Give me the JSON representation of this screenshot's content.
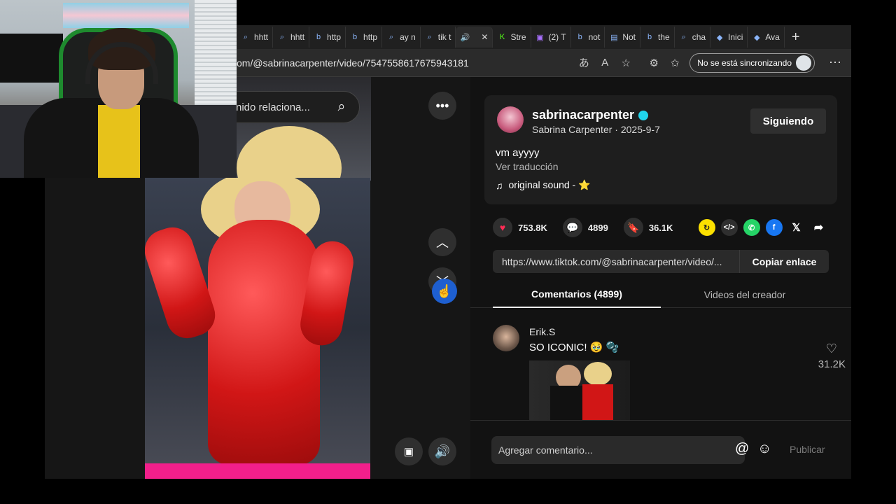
{
  "browser": {
    "tabs": [
      {
        "label": "hhtt",
        "icon": "search-icon"
      },
      {
        "label": "hhtt",
        "icon": "search-icon"
      },
      {
        "label": "http",
        "icon": "bing-icon"
      },
      {
        "label": "http",
        "icon": "bing-icon"
      },
      {
        "label": "ay n",
        "icon": "search-icon"
      },
      {
        "label": "tik t",
        "icon": "search-icon"
      },
      {
        "label": "",
        "icon": "speaker-icon",
        "active": true
      },
      {
        "label": "Stre",
        "icon": "kick-icon"
      },
      {
        "label": "(2) T",
        "icon": "twitch-icon"
      },
      {
        "label": "not",
        "icon": "bing-icon"
      },
      {
        "label": "Not",
        "icon": "page-icon"
      },
      {
        "label": "the",
        "icon": "bing-icon"
      },
      {
        "label": "cha",
        "icon": "search-icon"
      },
      {
        "label": "Inici",
        "icon": "roblox-icon"
      },
      {
        "label": "Ava",
        "icon": "roblox-icon"
      }
    ],
    "close_glyph": "✕",
    "new_tab_glyph": "+",
    "url": "om/@sabrinacarpenter/video/7547558617675943181",
    "sync_label": "No se está sincronizando"
  },
  "video": {
    "search_text": "nido relaciona..."
  },
  "post": {
    "username": "sabrinacarpenter",
    "subline": "Sabrina Carpenter · 2025-9-7",
    "follow_label": "Siguiendo",
    "caption": "vm ayyyy",
    "translate_label": "Ver traducción",
    "sound": "original sound - ⭐"
  },
  "stats": {
    "likes": "753.8K",
    "comments": "4899",
    "saves": "36.1K"
  },
  "share": {
    "link": "https://www.tiktok.com/@sabrinacarpenter/video/...",
    "copy_label": "Copiar enlace"
  },
  "tabs": {
    "comments_label": "Comentarios (4899)",
    "creator_label": "Videos del creador"
  },
  "comment": {
    "user": "Erik.S",
    "text": "SO ICONIC! 🥹 🫧",
    "likes": "31.2K"
  },
  "compose": {
    "placeholder": "Agregar comentario...",
    "publish_label": "Publicar"
  },
  "colors": {
    "like_pink": "#fe2c55",
    "verified": "#20d5ec",
    "whatsapp": "#25d366",
    "facebook": "#1877f2",
    "embed_yellow": "#fce000"
  }
}
